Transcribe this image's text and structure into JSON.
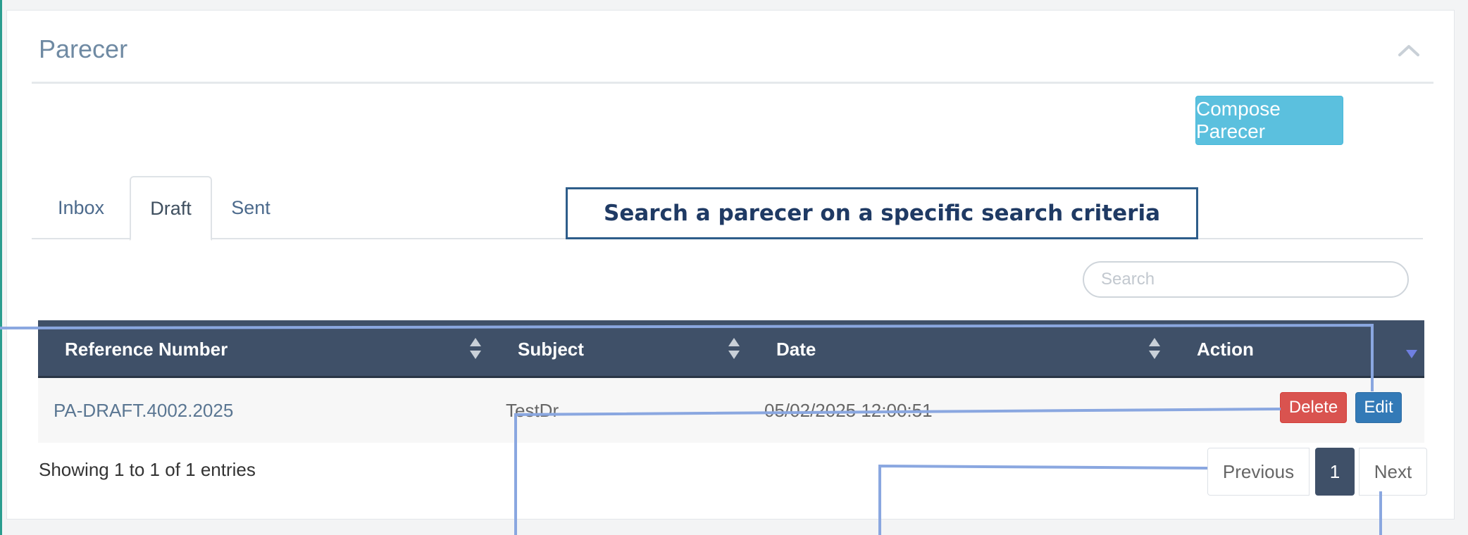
{
  "panel": {
    "title": "Parecer",
    "compose_label": "Compose Parecer"
  },
  "tabs": [
    {
      "label": "Inbox",
      "active": false
    },
    {
      "label": "Draft",
      "active": true
    },
    {
      "label": "Sent",
      "active": false
    }
  ],
  "callout": {
    "text": "Search a parecer on a specific search criteria"
  },
  "search": {
    "placeholder": "Search",
    "value": ""
  },
  "table": {
    "columns": [
      "Reference Number",
      "Subject",
      "Date",
      "Action"
    ],
    "rows": [
      {
        "reference": "PA-DRAFT.4002.2025",
        "subject": "TestDr",
        "date": "05/02/2025 12:00:51",
        "actions": {
          "delete": "Delete",
          "edit": "Edit"
        }
      }
    ]
  },
  "footer": {
    "info": "Showing 1 to 1 of 1 entries",
    "previous_label": "Previous",
    "current_page": "1",
    "next_label": "Next"
  },
  "colors": {
    "header_bg": "#3f5068",
    "compose": "#5bc0de",
    "delete": "#d9534f",
    "edit": "#337ab7",
    "callout_border": "#2e5d8a",
    "annotation_line": "#8aa7e0"
  },
  "icons": {
    "collapse": "chevron-up-icon",
    "sort": "sort-icon",
    "column_menu": "caret-down-icon"
  }
}
